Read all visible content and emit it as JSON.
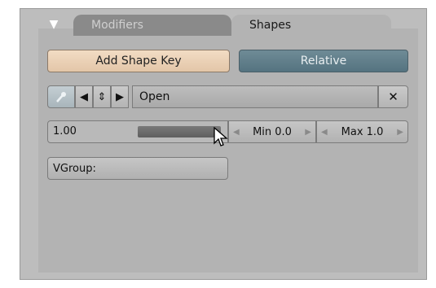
{
  "tabs": {
    "collapse_icon": "triangle-down-icon",
    "collapse_glyph": "▼",
    "modifiers_label": "Modifiers",
    "shapes_label": "Shapes"
  },
  "buttons": {
    "add_shape_key": "Add Shape Key",
    "relative": "Relative"
  },
  "shape_key_row": {
    "pin_icon": "pin-icon",
    "prev_glyph": "◀",
    "updown_glyph": "⇕",
    "next_glyph": "▶",
    "name": "Open",
    "close_glyph": "✕"
  },
  "slider": {
    "value": "1.00",
    "fill_fraction": 1.0,
    "min_label": "Min 0.0",
    "max_label": "Max 1.0",
    "left_arrow": "◀",
    "right_arrow": "▶"
  },
  "vgroup": {
    "label": "VGroup:"
  },
  "colors": {
    "accent_relative": "#5f7d89",
    "add_button": "#ead1b6",
    "panel_bg": "#b3b3b3"
  }
}
